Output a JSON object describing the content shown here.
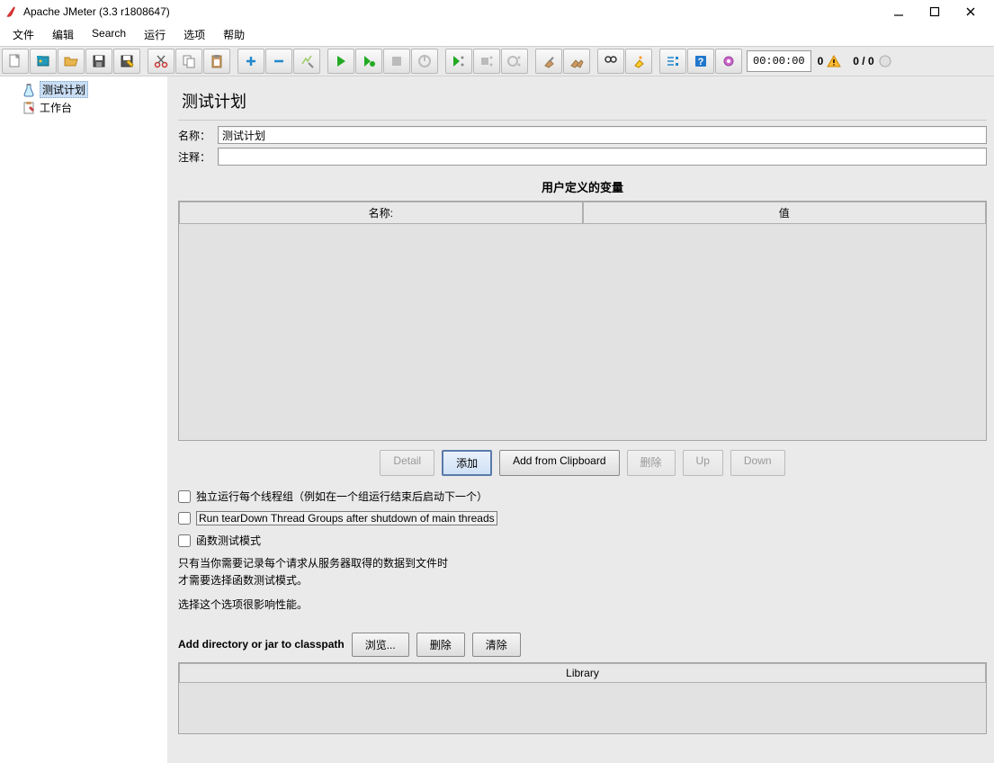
{
  "window": {
    "title": "Apache JMeter (3.3 r1808647)"
  },
  "menu": {
    "file": "文件",
    "edit": "编辑",
    "search": "Search",
    "run": "运行",
    "options": "选项",
    "help": "帮助"
  },
  "toolbar": {
    "time": "00:00:00",
    "warn_count": "0",
    "threads": "0 / 0"
  },
  "tree": {
    "items": [
      {
        "label": "测试计划",
        "icon": "flask",
        "selected": true
      },
      {
        "label": "工作台",
        "icon": "clipboard",
        "selected": false
      }
    ]
  },
  "panel": {
    "title": "测试计划",
    "name_label": "名称：",
    "name_value": "测试计划",
    "comment_label": "注释：",
    "comment_value": "",
    "vars_section": "用户定义的变量",
    "col_name": "名称:",
    "col_value": "值",
    "buttons": {
      "detail": "Detail",
      "add": "添加",
      "clipboard": "Add from Clipboard",
      "delete": "删除",
      "up": "Up",
      "down": "Down"
    },
    "checks": {
      "serial": "独立运行每个线程组（例如在一个组运行结束后启动下一个）",
      "teardown": "Run tearDown Thread Groups after shutdown of main threads",
      "functional": "函数测试模式"
    },
    "help1": "只有当你需要记录每个请求从服务器取得的数据到文件时",
    "help2": "才需要选择函数测试模式。",
    "help3": "选择这个选项很影响性能。",
    "classpath_label": "Add directory or jar to classpath",
    "classpath_buttons": {
      "browse": "浏览...",
      "delete": "删除",
      "clear": "清除"
    },
    "lib_header": "Library"
  }
}
